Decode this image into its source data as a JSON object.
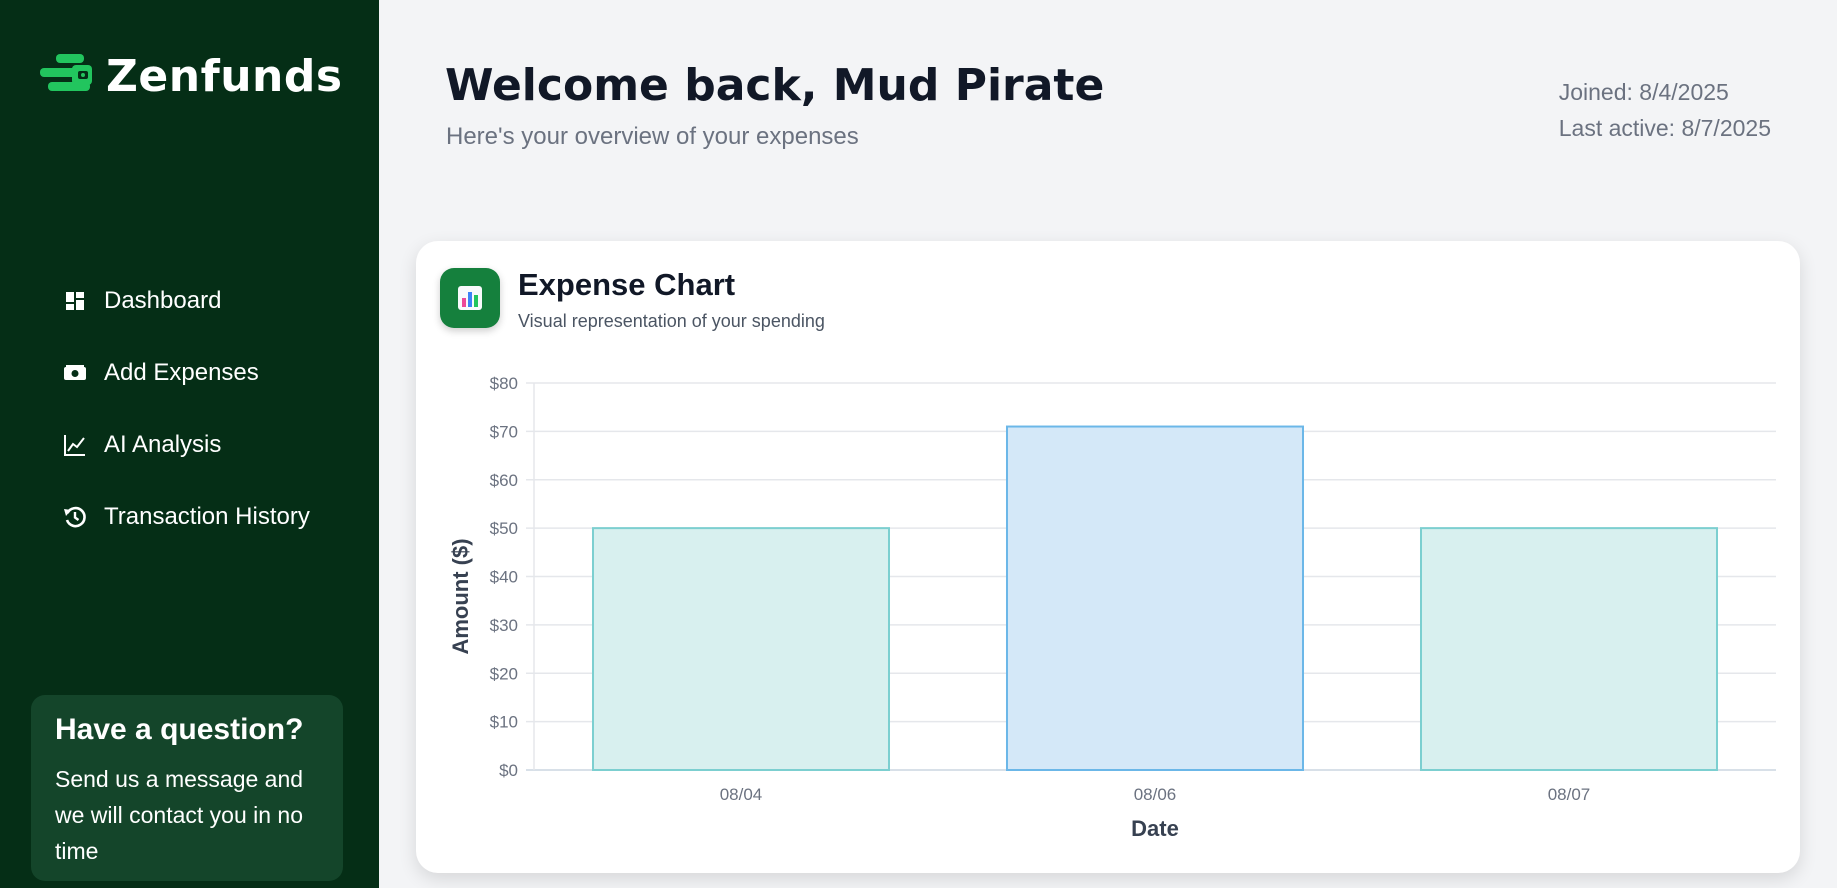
{
  "sidebar": {
    "brand": "Zenfunds",
    "items": [
      {
        "label": "Dashboard",
        "icon": "dashboard-icon"
      },
      {
        "label": "Add Expenses",
        "icon": "money-icon"
      },
      {
        "label": "AI Analysis",
        "icon": "line-chart-icon"
      },
      {
        "label": "Transaction History",
        "icon": "history-icon"
      }
    ],
    "help": {
      "title": "Have a question?",
      "text": "Send us a message and we will contact you in no time"
    }
  },
  "header": {
    "title": "Welcome back, Mud Pirate",
    "subtitle": "Here's your overview of your expenses",
    "joined": "Joined: 8/4/2025",
    "last_active": "Last active: 8/7/2025"
  },
  "card": {
    "icon": "bar-chart-icon",
    "title": "Expense Chart",
    "subtitle": "Visual representation of your spending"
  },
  "colors": {
    "sidebar_bg": "#052e16",
    "brand_green": "#22c55e",
    "bar_teal_fill": "#d8f0ef",
    "bar_teal_stroke": "#7ccfd0",
    "bar_blue_fill": "#d4e8f8",
    "bar_blue_stroke": "#6bb7e8"
  },
  "chart_data": {
    "type": "bar",
    "categories": [
      "08/04",
      "08/06",
      "08/07"
    ],
    "values": [
      50,
      71,
      50
    ],
    "xlabel": "Date",
    "ylabel": "Amount ($)",
    "ylim": [
      0,
      80
    ],
    "yticks": [
      "$0",
      "$10",
      "$20",
      "$30",
      "$40",
      "$50",
      "$60",
      "$70",
      "$80"
    ],
    "grid": true
  }
}
